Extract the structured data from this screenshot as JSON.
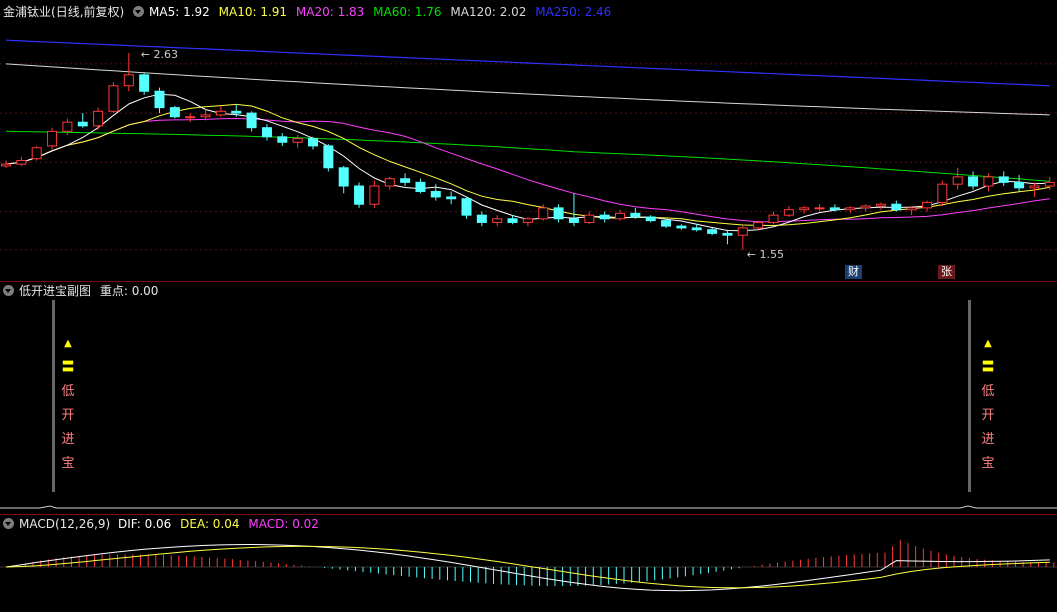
{
  "main_header": {
    "stock_name": "金浦钛业",
    "adjust": "(日线,前复权)",
    "ma5": "MA5: 1.92",
    "ma10": "MA10: 1.91",
    "ma20": "MA20: 1.83",
    "ma60": "MA60: 1.76",
    "ma120": "MA120: 2.02",
    "ma250": "MA250: 2.46"
  },
  "high_label": "2.63",
  "low_label": "1.55",
  "tags": {
    "cai": "财",
    "zhang": "张"
  },
  "sub_header": {
    "title": "低开进宝副图",
    "focus": "重点: 0.00"
  },
  "signal_chars": [
    "▲",
    "〓",
    "低",
    "开",
    "进",
    "宝"
  ],
  "macd_header": {
    "title": "MACD(12,26,9)",
    "dif": "DIF: 0.06",
    "dea": "DEA: 0.04",
    "macd": "MACD: 0.02"
  },
  "colors": {
    "up": "#ff3a3a",
    "down": "#54ffff",
    "ma5": "#ffffff",
    "ma10": "#ffff40",
    "ma20": "#ff40ff",
    "ma60": "#00e000",
    "ma120": "#d8d8d8",
    "ma250": "#3030ff",
    "border": "#7a0d0d"
  },
  "chart_data": {
    "type": "candlestick",
    "ohlc": [
      [
        2.01,
        2.04,
        2.0,
        2.02
      ],
      [
        2.02,
        2.06,
        2.01,
        2.04
      ],
      [
        2.05,
        2.12,
        2.04,
        2.11
      ],
      [
        2.12,
        2.22,
        2.1,
        2.2
      ],
      [
        2.2,
        2.27,
        2.18,
        2.25
      ],
      [
        2.25,
        2.3,
        2.22,
        2.23
      ],
      [
        2.23,
        2.33,
        2.21,
        2.31
      ],
      [
        2.31,
        2.47,
        2.3,
        2.45
      ],
      [
        2.45,
        2.63,
        2.42,
        2.51
      ],
      [
        2.51,
        2.52,
        2.4,
        2.42
      ],
      [
        2.42,
        2.44,
        2.3,
        2.33
      ],
      [
        2.33,
        2.34,
        2.27,
        2.28
      ],
      [
        2.28,
        2.3,
        2.25,
        2.28
      ],
      [
        2.28,
        2.32,
        2.26,
        2.29
      ],
      [
        2.29,
        2.34,
        2.28,
        2.31
      ],
      [
        2.31,
        2.35,
        2.28,
        2.3
      ],
      [
        2.3,
        2.31,
        2.2,
        2.22
      ],
      [
        2.22,
        2.24,
        2.15,
        2.17
      ],
      [
        2.17,
        2.19,
        2.12,
        2.14
      ],
      [
        2.14,
        2.18,
        2.11,
        2.16
      ],
      [
        2.16,
        2.17,
        2.1,
        2.12
      ],
      [
        2.12,
        2.13,
        1.98,
        2.0
      ],
      [
        2.0,
        2.01,
        1.86,
        1.9
      ],
      [
        1.9,
        1.92,
        1.78,
        1.8
      ],
      [
        1.8,
        1.93,
        1.78,
        1.9
      ],
      [
        1.9,
        1.95,
        1.88,
        1.94
      ],
      [
        1.94,
        1.97,
        1.9,
        1.92
      ],
      [
        1.92,
        1.94,
        1.86,
        1.87
      ],
      [
        1.87,
        1.91,
        1.82,
        1.84
      ],
      [
        1.84,
        1.87,
        1.8,
        1.83
      ],
      [
        1.83,
        1.84,
        1.72,
        1.74
      ],
      [
        1.74,
        1.76,
        1.68,
        1.7
      ],
      [
        1.7,
        1.74,
        1.68,
        1.72
      ],
      [
        1.72,
        1.74,
        1.69,
        1.7
      ],
      [
        1.7,
        1.73,
        1.68,
        1.72
      ],
      [
        1.72,
        1.8,
        1.71,
        1.78
      ],
      [
        1.78,
        1.8,
        1.7,
        1.72
      ],
      [
        1.72,
        1.86,
        1.68,
        1.7
      ],
      [
        1.7,
        1.76,
        1.69,
        1.74
      ],
      [
        1.74,
        1.76,
        1.7,
        1.72
      ],
      [
        1.72,
        1.77,
        1.71,
        1.75
      ],
      [
        1.75,
        1.78,
        1.72,
        1.73
      ],
      [
        1.73,
        1.74,
        1.7,
        1.71
      ],
      [
        1.71,
        1.72,
        1.67,
        1.68
      ],
      [
        1.68,
        1.69,
        1.66,
        1.67
      ],
      [
        1.67,
        1.69,
        1.65,
        1.66
      ],
      [
        1.66,
        1.67,
        1.63,
        1.64
      ],
      [
        1.64,
        1.66,
        1.58,
        1.63
      ],
      [
        1.63,
        1.68,
        1.55,
        1.67
      ],
      [
        1.67,
        1.71,
        1.66,
        1.7
      ],
      [
        1.7,
        1.76,
        1.69,
        1.74
      ],
      [
        1.74,
        1.79,
        1.73,
        1.77
      ],
      [
        1.77,
        1.79,
        1.75,
        1.78
      ],
      [
        1.78,
        1.8,
        1.76,
        1.78
      ],
      [
        1.78,
        1.8,
        1.76,
        1.77
      ],
      [
        1.77,
        1.79,
        1.75,
        1.78
      ],
      [
        1.78,
        1.8,
        1.76,
        1.79
      ],
      [
        1.79,
        1.81,
        1.77,
        1.8
      ],
      [
        1.8,
        1.82,
        1.76,
        1.77
      ],
      [
        1.77,
        1.79,
        1.74,
        1.78
      ],
      [
        1.78,
        1.82,
        1.76,
        1.81
      ],
      [
        1.81,
        1.93,
        1.79,
        1.91
      ],
      [
        1.91,
        2.0,
        1.88,
        1.95
      ],
      [
        1.95,
        1.98,
        1.88,
        1.9
      ],
      [
        1.9,
        1.97,
        1.87,
        1.95
      ],
      [
        1.95,
        1.98,
        1.9,
        1.92
      ],
      [
        1.92,
        1.96,
        1.87,
        1.89
      ],
      [
        1.89,
        1.92,
        1.84,
        1.9
      ],
      [
        1.9,
        1.95,
        1.88,
        1.92
      ]
    ],
    "series": [
      {
        "name": "MA5",
        "last": 1.92
      },
      {
        "name": "MA10",
        "last": 1.91
      },
      {
        "name": "MA20",
        "last": 1.83
      },
      {
        "name": "MA60",
        "last": 1.76
      },
      {
        "name": "MA120",
        "last": 2.02
      },
      {
        "name": "MA250",
        "last": 2.46
      }
    ],
    "ylim": [
      1.45,
      2.8
    ],
    "macd": {
      "dif_last": 0.06,
      "dea_last": 0.04,
      "macd_last": 0.02
    }
  }
}
